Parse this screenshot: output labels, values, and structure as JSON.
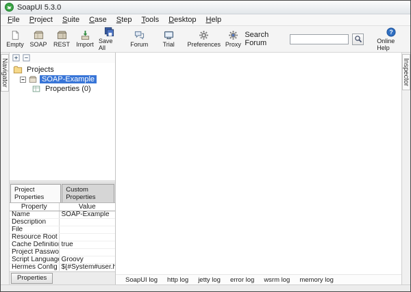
{
  "window": {
    "title": "SoapUI 5.3.0",
    "logo_icon": "soapui-logo-icon"
  },
  "menu": {
    "items": [
      "File",
      "Project",
      "Suite",
      "Case",
      "Step",
      "Tools",
      "Desktop",
      "Help"
    ]
  },
  "toolbar": {
    "buttons": [
      {
        "label": "Empty",
        "icon": "empty-project-icon"
      },
      {
        "label": "SOAP",
        "icon": "soap-project-icon"
      },
      {
        "label": "REST",
        "icon": "rest-project-icon"
      },
      {
        "label": "Import",
        "icon": "import-project-icon"
      },
      {
        "label": "Save All",
        "icon": "save-all-icon"
      },
      {
        "label": "Forum",
        "icon": "forum-icon"
      },
      {
        "label": "Trial",
        "icon": "trial-icon"
      },
      {
        "label": "Preferences",
        "icon": "preferences-gear-icon"
      },
      {
        "label": "Proxy",
        "icon": "proxy-gear-icon"
      }
    ],
    "search": {
      "label": "Search Forum",
      "value": "",
      "button_icon": "search-icon"
    },
    "help": {
      "label": "Online Help",
      "icon": "help-icon"
    }
  },
  "navigator": {
    "tab": "Navigator",
    "tree": [
      {
        "label": "Projects",
        "icon": "folder-icon",
        "level": 0,
        "selected": false
      },
      {
        "label": "SOAP-Example",
        "icon": "project-icon",
        "level": 1,
        "selected": true
      },
      {
        "label": "Properties (0)",
        "icon": "properties-table-icon",
        "level": 2,
        "selected": false
      }
    ]
  },
  "inspector": {
    "tab": "Inspector"
  },
  "properties_panel": {
    "tabs": [
      {
        "label": "Project Properties",
        "active": true
      },
      {
        "label": "Custom Properties",
        "active": false
      }
    ],
    "table": {
      "headers": [
        "Property",
        "Value"
      ],
      "rows": [
        {
          "property": "Name",
          "value": "SOAP-Example"
        },
        {
          "property": "Description",
          "value": ""
        },
        {
          "property": "File",
          "value": ""
        },
        {
          "property": "Resource Root",
          "value": ""
        },
        {
          "property": "Cache Definitions",
          "value": "true"
        },
        {
          "property": "Project Password",
          "value": ""
        },
        {
          "property": "Script Language",
          "value": "Groovy"
        },
        {
          "property": "Hermes Config",
          "value": "${#System#user.ho..."
        }
      ]
    },
    "bottom_button": "Properties"
  },
  "logs": {
    "tabs": [
      "SoapUI log",
      "http log",
      "jetty log",
      "error log",
      "wsrm log",
      "memory log"
    ]
  }
}
